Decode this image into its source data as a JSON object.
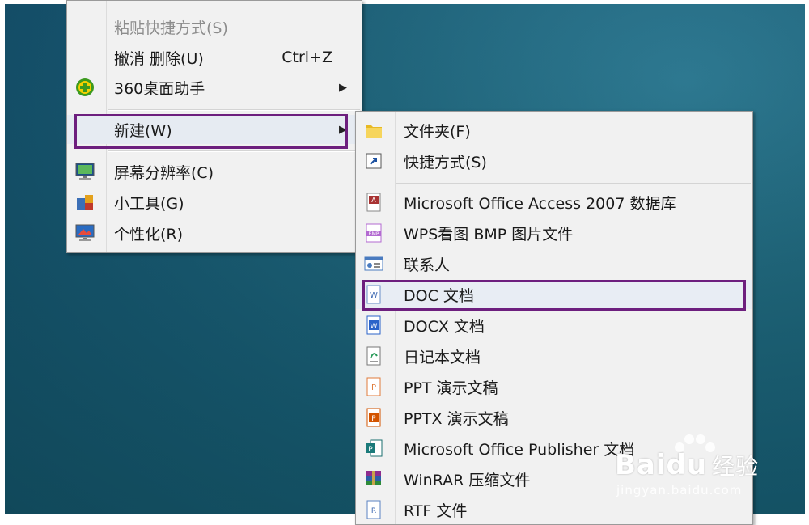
{
  "menu1": {
    "items": [
      {
        "label": "粘贴快捷方式(S)",
        "disabled": true
      },
      {
        "label": "撤消 删除(U)",
        "shortcut": "Ctrl+Z"
      },
      {
        "label": "360桌面助手",
        "icon": "360-assistant-icon",
        "submenu": true
      },
      {
        "label": "新建(W)",
        "submenu": true
      },
      {
        "label": "屏幕分辨率(C)",
        "icon": "screen-resolution-icon"
      },
      {
        "label": "小工具(G)",
        "icon": "gadgets-icon"
      },
      {
        "label": "个性化(R)",
        "icon": "personalize-icon"
      }
    ]
  },
  "submenu": {
    "items": [
      {
        "label": "文件夹(F)",
        "icon": "folder-icon"
      },
      {
        "label": "快捷方式(S)",
        "icon": "shortcut-icon"
      },
      {
        "label": "Microsoft Office Access 2007 数据库",
        "icon": "access-db-icon"
      },
      {
        "label": "WPS看图 BMP 图片文件",
        "icon": "bmp-image-icon"
      },
      {
        "label": "联系人",
        "icon": "contact-icon"
      },
      {
        "label": "DOC 文档",
        "icon": "doc-icon"
      },
      {
        "label": "DOCX 文档",
        "icon": "docx-icon"
      },
      {
        "label": "日记本文档",
        "icon": "journal-icon"
      },
      {
        "label": "PPT 演示文稿",
        "icon": "ppt-icon"
      },
      {
        "label": "PPTX 演示文稿",
        "icon": "pptx-icon"
      },
      {
        "label": "Microsoft Office Publisher 文档",
        "icon": "publisher-icon"
      },
      {
        "label": "WinRAR 压缩文件",
        "icon": "winrar-icon"
      },
      {
        "label": "RTF 文件",
        "icon": "rtf-icon"
      }
    ]
  },
  "highlight_color": "#6d1f7e",
  "watermark": {
    "brand_left": "Bai",
    "brand_right": "du",
    "suffix": "经验",
    "url": "jingyan.baidu.com"
  }
}
